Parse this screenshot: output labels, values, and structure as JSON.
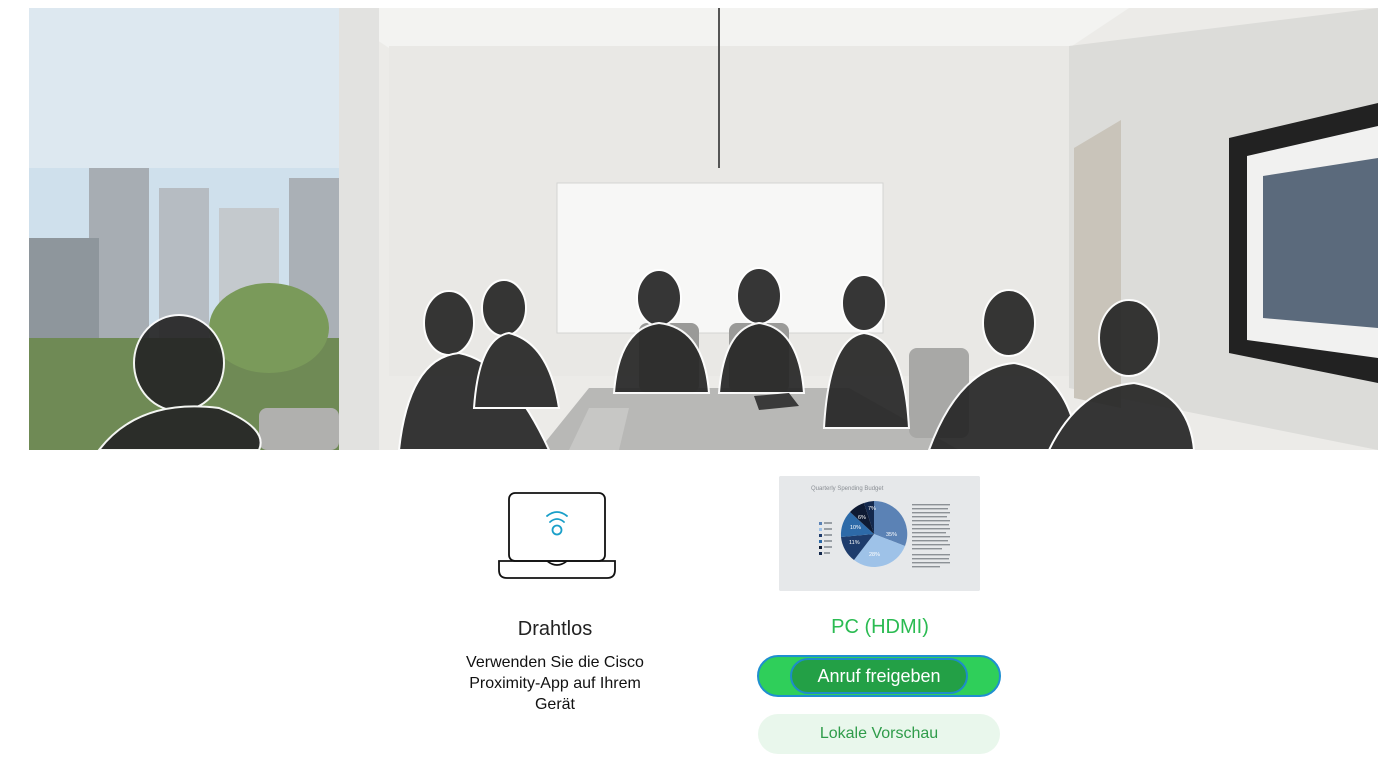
{
  "sources": {
    "wireless": {
      "title": "Drahtlos",
      "description": "Verwenden Sie die Cisco Proximity-App auf Ihrem Gerät",
      "icon": "laptop-wireless-icon"
    },
    "pc": {
      "title": "PC (HDMI)",
      "share_label": "Anruf freigeben",
      "preview_label": "Lokale Vorschau",
      "thumbnail": {
        "heading": "Quarterly Spending Budget",
        "slices": [
          {
            "label": "35%",
            "color": "#5b82b5"
          },
          {
            "label": "28%",
            "color": "#9ec2e8"
          },
          {
            "label": "11%",
            "color": "#1e3c6c"
          },
          {
            "label": "10%",
            "color": "#2d6aa8"
          },
          {
            "label": "6%",
            "color": "#0e1a33"
          },
          {
            "label": "7%",
            "color": "#13284d"
          }
        ]
      }
    }
  },
  "colors": {
    "accent_green": "#2bbb52",
    "share_fill": "#23a046",
    "share_border": "#1e8cc9",
    "preview_bg": "#e9f7ec"
  }
}
